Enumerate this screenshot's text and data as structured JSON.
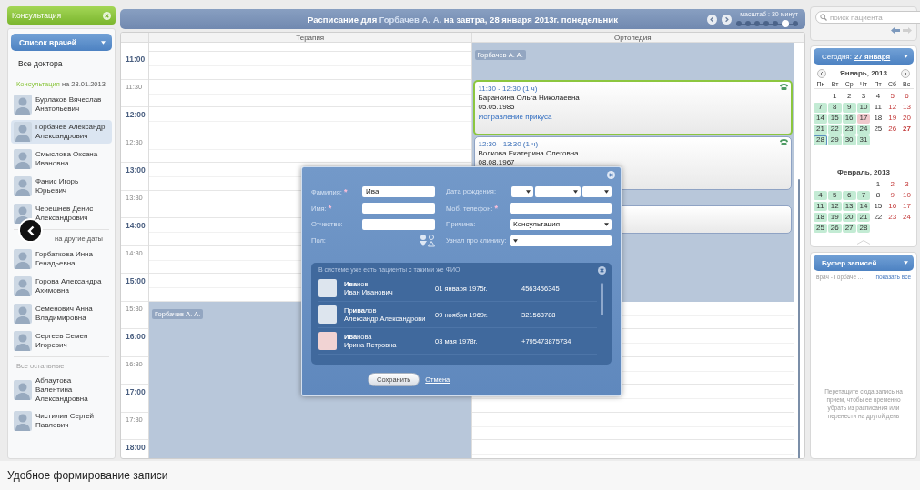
{
  "sidebar": {
    "title": "Консультация",
    "doctor_list": "Список врачей",
    "all_doctors": "Все доктора",
    "sections": [
      {
        "highlight": "Консультация",
        "title": "на 28.01.2013",
        "muted": false,
        "doctors": [
          {
            "name": "Бурлаков Вячеслав Анатольевич",
            "selected": false
          },
          {
            "name": "Горбачев Александр Александрович",
            "selected": true
          },
          {
            "name": "Смыслова Оксана Ивановна",
            "selected": false
          },
          {
            "name": "Фанис Игорь Юрьевич",
            "selected": false
          },
          {
            "name": "Черешнев Денис Александрович",
            "selected": false
          }
        ]
      },
      {
        "title": "на другие даты",
        "muted": false,
        "doctors": [
          {
            "name": "Горбаткова Инна Генадьевна",
            "selected": false
          },
          {
            "name": "Горова Александра Ахимовна",
            "selected": false
          },
          {
            "name": "Семенович Анна Владимировна",
            "selected": false
          },
          {
            "name": "Сергеев Семен Игоревич",
            "selected": false
          }
        ]
      },
      {
        "title": "Все остальные",
        "muted": true,
        "doctors": [
          {
            "name": "Аблаутова Валентина Александровна",
            "selected": false
          },
          {
            "name": "Чистилин Сергей Павлович",
            "selected": false
          }
        ]
      }
    ]
  },
  "schedule": {
    "title_prefix": "Расписание для",
    "doctor": "Горбачев А. А.",
    "title_suffix": "на завтра, 28 января 2013г. понедельник",
    "scale_label": "масштаб : 30 минут",
    "scale_steps": [
      {
        "selected": false
      },
      {
        "selected": false
      },
      {
        "selected": false
      },
      {
        "selected": false
      },
      {
        "selected": false
      },
      {
        "selected": true
      },
      {
        "selected": false
      }
    ],
    "columns": [
      {
        "name": "Терапия",
        "blocks": [
          {
            "kind": "shift",
            "doctor": "Горбачев А. А."
          }
        ]
      },
      {
        "name": "Ортопедия",
        "blocks": [
          {
            "kind": "shift",
            "doctor": "Горбачев А. А."
          },
          {
            "kind": "appointment",
            "time": "11:30 - 12:30 (1 ч)",
            "patient": "Баранкина Ольга Николаевна",
            "birth_date": "05.05.1985",
            "reason": "Исправление прикуса",
            "selected": true
          },
          {
            "kind": "appointment",
            "time": "12:30 - 13:30 (1 ч)",
            "patient": "Волкова Екатерина Олеговна",
            "birth_date": "08.08.1967",
            "selected": false
          },
          {
            "kind": "appointment",
            "selected": false
          }
        ]
      }
    ],
    "times": [
      {
        "label": "11:00",
        "hour": true
      },
      {
        "label": "11:30",
        "hour": false
      },
      {
        "label": "12:00",
        "hour": true
      },
      {
        "label": "12:30",
        "hour": false
      },
      {
        "label": "13:00",
        "hour": true
      },
      {
        "label": "13:30",
        "hour": false
      },
      {
        "label": "14:00",
        "hour": true
      },
      {
        "label": "14:30",
        "hour": false
      },
      {
        "label": "15:00",
        "hour": true
      },
      {
        "label": "15:30",
        "hour": false
      },
      {
        "label": "16:00",
        "hour": true
      },
      {
        "label": "16:30",
        "hour": false
      },
      {
        "label": "17:00",
        "hour": true
      },
      {
        "label": "17:30",
        "hour": false
      },
      {
        "label": "18:00",
        "hour": true
      }
    ]
  },
  "patient_form": {
    "fields": [
      {
        "label": "Фамилия:",
        "required_mark": "*",
        "kind": "text",
        "value": "Ива"
      },
      {
        "label": "Имя:",
        "required_mark": "*",
        "kind": "text"
      },
      {
        "label": "Отчество:",
        "kind": "text"
      },
      {
        "label": "Пол:",
        "kind": "gender"
      },
      {
        "label": "Дата рождения:",
        "kind": "date"
      },
      {
        "label": "Моб. телефон:",
        "required_mark": "*",
        "kind": "text"
      },
      {
        "label": "Причина:",
        "kind": "select",
        "value": "Консультация"
      },
      {
        "label": "Узнал про клинику:",
        "kind": "select"
      }
    ],
    "duplicates": {
      "title": "В системе уже есть пациенты с такими же ФИО",
      "patients": [
        {
          "surname": "**Ива**нов",
          "given_names": "Иван Иванович",
          "birth_date": "01 января 1975г.",
          "phone": "4563456345",
          "female": false
        },
        {
          "surname": "Пр**ива**лов",
          "given_names": "Александр Александрови",
          "birth_date": "09 ноября 1969г.",
          "phone": "321568788",
          "female": false
        },
        {
          "surname": "**Ива**нова",
          "given_names": "Ирина Петровна",
          "birth_date": "03 мая 1978г.",
          "phone": "+795473875734",
          "female": true
        }
      ]
    },
    "save": "Сохранить",
    "cancel": "Отмена"
  },
  "right_panel": {
    "search": {
      "placeholder": "поиск пациента"
    },
    "calendar": {
      "today_label": "Сегодня:",
      "today_date": "27 января",
      "months": [
        {
          "title": "Январь, 2013",
          "nav": true,
          "weekdays": [
            "Пн",
            "Вт",
            "Ср",
            "Чт",
            "Пт",
            "Сб",
            "Вс"
          ],
          "days": [
            {
              "kind": "empty"
            },
            {
              "kind": "day",
              "day": "1",
              "working": false,
              "marked": false,
              "weekend": false,
              "today": false,
              "selected": false
            },
            {
              "kind": "day",
              "day": "2",
              "working": false,
              "marked": false,
              "weekend": false,
              "today": false,
              "selected": false
            },
            {
              "kind": "day",
              "day": "3",
              "working": false,
              "marked": false,
              "weekend": false,
              "today": false,
              "selected": false
            },
            {
              "kind": "day",
              "day": "4",
              "working": false,
              "marked": false,
              "weekend": false,
              "today": false,
              "selected": false
            },
            {
              "kind": "day",
              "day": "5",
              "working": false,
              "marked": false,
              "weekend": true,
              "today": false,
              "selected": false
            },
            {
              "kind": "day",
              "day": "6",
              "working": false,
              "marked": false,
              "weekend": true,
              "today": false,
              "selected": false
            },
            {
              "kind": "day",
              "day": "7",
              "working": true,
              "marked": false,
              "weekend": false,
              "today": false,
              "selected": false
            },
            {
              "kind": "day",
              "day": "8",
              "working": true,
              "marked": false,
              "weekend": false,
              "today": false,
              "selected": false
            },
            {
              "kind": "day",
              "day": "9",
              "working": true,
              "marked": false,
              "weekend": false,
              "today": false,
              "selected": false
            },
            {
              "kind": "day",
              "day": "10",
              "working": true,
              "marked": false,
              "weekend": false,
              "today": false,
              "selected": false
            },
            {
              "kind": "day",
              "day": "11",
              "working": false,
              "marked": false,
              "weekend": false,
              "today": false,
              "selected": false
            },
            {
              "kind": "day",
              "day": "12",
              "working": false,
              "marked": false,
              "weekend": true,
              "today": false,
              "selected": false
            },
            {
              "kind": "day",
              "day": "13",
              "working": false,
              "marked": false,
              "weekend": true,
              "today": false,
              "selected": false
            },
            {
              "kind": "day",
              "day": "14",
              "working": true,
              "marked": false,
              "weekend": false,
              "today": false,
              "selected": false
            },
            {
              "kind": "day",
              "day": "15",
              "working": true,
              "marked": false,
              "weekend": false,
              "today": false,
              "selected": false
            },
            {
              "kind": "day",
              "day": "16",
              "working": true,
              "marked": false,
              "weekend": false,
              "today": false,
              "selected": false
            },
            {
              "kind": "day",
              "day": "17",
              "working": false,
              "marked": true,
              "weekend": false,
              "today": false,
              "selected": false
            },
            {
              "kind": "day",
              "day": "18",
              "working": false,
              "marked": false,
              "weekend": false,
              "today": false,
              "selected": false
            },
            {
              "kind": "day",
              "day": "19",
              "working": false,
              "marked": false,
              "weekend": true,
              "today": false,
              "selected": false
            },
            {
              "kind": "day",
              "day": "20",
              "working": false,
              "marked": false,
              "weekend": true,
              "today": false,
              "selected": false
            },
            {
              "kind": "day",
              "day": "21",
              "working": true,
              "marked": false,
              "weekend": false,
              "today": false,
              "selected": false
            },
            {
              "kind": "day",
              "day": "22",
              "working": true,
              "marked": false,
              "weekend": false,
              "today": false,
              "selected": false
            },
            {
              "kind": "day",
              "day": "23",
              "working": true,
              "marked": false,
              "weekend": false,
              "today": false,
              "selected": false
            },
            {
              "kind": "day",
              "day": "24",
              "working": true,
              "marked": false,
              "weekend": false,
              "today": false,
              "selected": false
            },
            {
              "kind": "day",
              "day": "25",
              "working": false,
              "marked": false,
              "weekend": false,
              "today": false,
              "selected": false
            },
            {
              "kind": "day",
              "day": "26",
              "working": false,
              "marked": false,
              "weekend": true,
              "today": false,
              "selected": false
            },
            {
              "kind": "day",
              "day": "27",
              "working": false,
              "marked": false,
              "weekend": true,
              "today": true,
              "selected": false
            },
            {
              "kind": "day",
              "day": "28",
              "working": true,
              "marked": false,
              "weekend": false,
              "today": false,
              "selected": true
            },
            {
              "kind": "day",
              "day": "29",
              "working": true,
              "marked": false,
              "weekend": false,
              "today": false,
              "selected": false
            },
            {
              "kind": "day",
              "day": "30",
              "working": true,
              "marked": false,
              "weekend": false,
              "today": false,
              "selected": false
            },
            {
              "kind": "day",
              "day": "31",
              "working": true,
              "marked": false,
              "weekend": false,
              "today": false,
              "selected": false
            }
          ]
        },
        {
          "title": "Февраль, 2013",
          "nav": false,
          "days": [
            {
              "kind": "empty"
            },
            {
              "kind": "empty"
            },
            {
              "kind": "empty"
            },
            {
              "kind": "empty"
            },
            {
              "kind": "day",
              "day": "1",
              "working": false,
              "marked": false,
              "weekend": false,
              "today": false,
              "selected": false
            },
            {
              "kind": "day",
              "day": "2",
              "working": false,
              "marked": false,
              "weekend": true,
              "today": false,
              "selected": false
            },
            {
              "kind": "day",
              "day": "3",
              "working": false,
              "marked": false,
              "weekend": true,
              "today": false,
              "selected": false
            },
            {
              "kind": "day",
              "day": "4",
              "working": true,
              "marked": false,
              "weekend": false,
              "today": false,
              "selected": false
            },
            {
              "kind": "day",
              "day": "5",
              "working": true,
              "marked": false,
              "weekend": false,
              "today": false,
              "selected": false
            },
            {
              "kind": "day",
              "day": "6",
              "working": true,
              "marked": false,
              "weekend": false,
              "today": false,
              "selected": false
            },
            {
              "kind": "day",
              "day": "7",
              "working": true,
              "marked": false,
              "weekend": false,
              "today": false,
              "selected": false
            },
            {
              "kind": "day",
              "day": "8",
              "working": false,
              "marked": false,
              "weekend": false,
              "today": false,
              "selected": false
            },
            {
              "kind": "day",
              "day": "9",
              "working": false,
              "marked": false,
              "weekend": true,
              "today": false,
              "selected": false
            },
            {
              "kind": "day",
              "day": "10",
              "working": false,
              "marked": false,
              "weekend": true,
              "today": false,
              "selected": false
            },
            {
              "kind": "day",
              "day": "11",
              "working": true,
              "marked": false,
              "weekend": false,
              "today": false,
              "selected": false
            },
            {
              "kind": "day",
              "day": "12",
              "working": true,
              "marked": false,
              "weekend": false,
              "today": false,
              "selected": false
            },
            {
              "kind": "day",
              "day": "13",
              "working": true,
              "marked": false,
              "weekend": false,
              "today": false,
              "selected": false
            },
            {
              "kind": "day",
              "day": "14",
              "working": true,
              "marked": false,
              "weekend": false,
              "today": false,
              "selected": false
            },
            {
              "kind": "day",
              "day": "15",
              "working": false,
              "marked": false,
              "weekend": false,
              "today": false,
              "selected": false
            },
            {
              "kind": "day",
              "day": "16",
              "working": false,
              "marked": false,
              "weekend": true,
              "today": false,
              "selected": false
            },
            {
              "kind": "day",
              "day": "17",
              "working": false,
              "marked": false,
              "weekend": true,
              "today": false,
              "selected": false
            },
            {
              "kind": "day",
              "day": "18",
              "working": true,
              "marked": false,
              "weekend": false,
              "today": false,
              "selected": false
            },
            {
              "kind": "day",
              "day": "19",
              "working": true,
              "marked": false,
              "weekend": false,
              "today": false,
              "selected": false
            },
            {
              "kind": "day",
              "day": "20",
              "working": true,
              "marked": false,
              "weekend": false,
              "today": false,
              "selected": false
            },
            {
              "kind": "day",
              "day": "21",
              "working": true,
              "marked": false,
              "weekend": false,
              "today": false,
              "selected": false
            },
            {
              "kind": "day",
              "day": "22",
              "working": false,
              "marked": false,
              "weekend": false,
              "today": false,
              "selected": false
            },
            {
              "kind": "day",
              "day": "23",
              "working": false,
              "marked": false,
              "weekend": true,
              "today": false,
              "selected": false
            },
            {
              "kind": "day",
              "day": "24",
              "working": false,
              "marked": false,
              "weekend": true,
              "today": false,
              "selected": false
            },
            {
              "kind": "day",
              "day": "25",
              "working": true,
              "marked": false,
              "weekend": false,
              "today": false,
              "selected": false
            },
            {
              "kind": "day",
              "day": "26",
              "working": true,
              "marked": false,
              "weekend": false,
              "today": false,
              "selected": false
            },
            {
              "kind": "day",
              "day": "27",
              "working": true,
              "marked": false,
              "weekend": false,
              "today": false,
              "selected": false
            },
            {
              "kind": "day",
              "day": "28",
              "working": true,
              "marked": false,
              "weekend": false,
              "today": false,
              "selected": false
            }
          ]
        }
      ]
    },
    "buffer": {
      "title": "Буфер записей",
      "doctor_filter": "врач - Горбаче ...",
      "show_all": "показать все",
      "hint": "Перетащите сюда запись на прием, чтобы ее временно убрать из расписания или перенести на другой день"
    }
  },
  "caption": "Удобное формирование записи"
}
